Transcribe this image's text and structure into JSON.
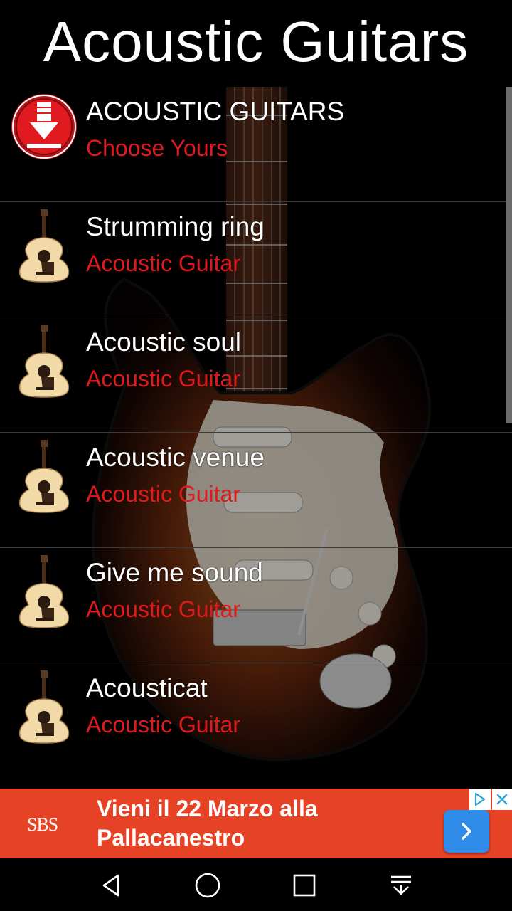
{
  "app": {
    "title": "Acoustic Guitars"
  },
  "list": {
    "items": [
      {
        "name": "ACOUSTIC GUITARS",
        "subtitle": "Choose Yours",
        "icon": "download-badge-icon"
      },
      {
        "name": "Strumming ring",
        "subtitle": "Acoustic Guitar",
        "icon": "acoustic-guitar-icon"
      },
      {
        "name": "Acoustic soul",
        "subtitle": "Acoustic Guitar",
        "icon": "acoustic-guitar-icon"
      },
      {
        "name": "Acoustic venue",
        "subtitle": "Acoustic Guitar",
        "icon": "acoustic-guitar-icon"
      },
      {
        "name": "Give me sound",
        "subtitle": "Acoustic Guitar",
        "icon": "acoustic-guitar-icon"
      },
      {
        "name": "Acousticat",
        "subtitle": "Acoustic Guitar",
        "icon": "acoustic-guitar-icon"
      }
    ]
  },
  "ad": {
    "brand": "SBS",
    "text": "Vieni il 22 Marzo alla Pallacanestro",
    "background": "#e64226",
    "cta_color": "#2f8be8"
  },
  "colors": {
    "accent": "#e0191c",
    "background": "#000000"
  },
  "navbar": {
    "icons": [
      "back-icon",
      "home-icon",
      "recents-icon",
      "notifications-pull-icon"
    ]
  }
}
